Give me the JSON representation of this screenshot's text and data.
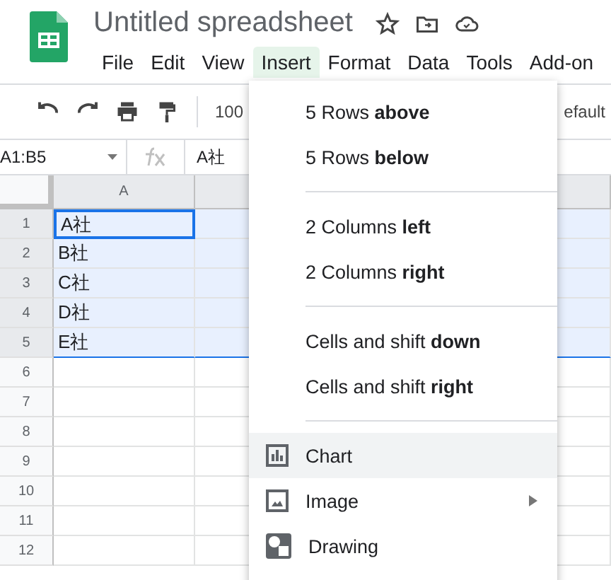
{
  "document": {
    "title": "Untitled spreadsheet"
  },
  "menubar": [
    {
      "label": "File",
      "selected": false
    },
    {
      "label": "Edit",
      "selected": false
    },
    {
      "label": "View",
      "selected": false
    },
    {
      "label": "Insert",
      "selected": true
    },
    {
      "label": "Format",
      "selected": false
    },
    {
      "label": "Data",
      "selected": false
    },
    {
      "label": "Tools",
      "selected": false
    },
    {
      "label": "Add-on",
      "selected": false
    }
  ],
  "toolbar": {
    "zoom": "100",
    "font": "efault"
  },
  "formula_bar": {
    "name_box": "A1:B5",
    "value": "A社"
  },
  "sheet": {
    "columns": [
      "A"
    ],
    "rows": [
      {
        "number": "1",
        "cell": "A社",
        "selected": true,
        "active": true
      },
      {
        "number": "2",
        "cell": "B社",
        "selected": true,
        "active": false
      },
      {
        "number": "3",
        "cell": "C社",
        "selected": true,
        "active": false
      },
      {
        "number": "4",
        "cell": "D社",
        "selected": true,
        "active": false
      },
      {
        "number": "5",
        "cell": "E社",
        "selected": true,
        "active": false
      },
      {
        "number": "6",
        "selected": false,
        "active": false
      },
      {
        "number": "7",
        "selected": false,
        "active": false
      },
      {
        "number": "8",
        "selected": false,
        "active": false
      },
      {
        "number": "9",
        "selected": false,
        "active": false
      },
      {
        "number": "10",
        "selected": false,
        "active": false
      },
      {
        "number": "11",
        "selected": false,
        "active": false
      },
      {
        "number": "12",
        "selected": false,
        "active": false
      }
    ]
  },
  "insert_menu": [
    [
      {
        "label": "5 Rows **above**",
        "highlighted": false
      },
      {
        "label": "5 Rows **below**",
        "highlighted": false
      }
    ],
    [
      {
        "label": "2 Columns **left**",
        "highlighted": false
      },
      {
        "label": "2 Columns **right**",
        "highlighted": false
      }
    ],
    [
      {
        "label": "Cells and shift **down**",
        "highlighted": false
      },
      {
        "label": "Cells and shift **right**",
        "highlighted": false
      }
    ],
    [
      {
        "label": "Chart",
        "kind": "icon",
        "highlighted": true
      },
      {
        "label": "Image",
        "kind": "icon",
        "submenu": true,
        "highlighted": false
      },
      {
        "label": "Drawing",
        "kind": "icon",
        "highlighted": false
      }
    ]
  ]
}
